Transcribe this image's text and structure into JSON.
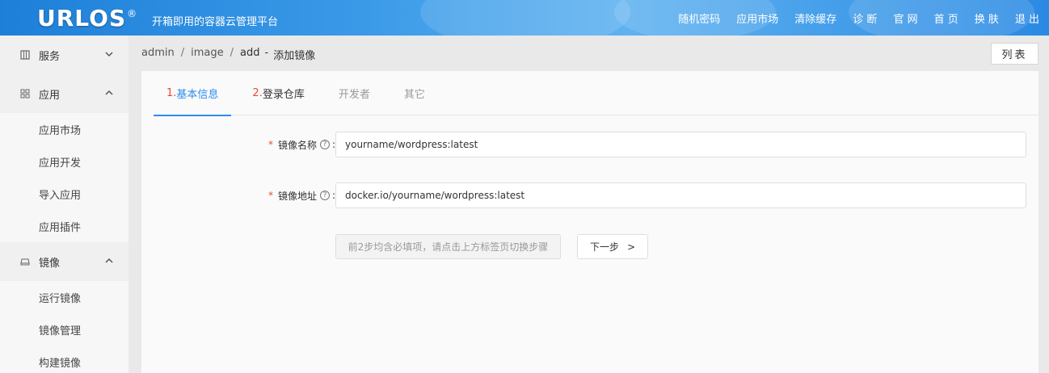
{
  "header": {
    "logo_text": "URLOS",
    "logo_mark": "®",
    "slogan": "开箱即用的容器云管理平台",
    "nav": [
      "随机密码",
      "应用市场",
      "清除缓存",
      "诊 断",
      "官 网",
      "首 页",
      "换 肤",
      "退 出"
    ]
  },
  "sidebar": {
    "groups": [
      {
        "label": "服务",
        "icon": "service-icon",
        "expanded": false,
        "items": []
      },
      {
        "label": "应用",
        "icon": "grid-icon",
        "expanded": true,
        "items": [
          "应用市场",
          "应用开发",
          "导入应用",
          "应用插件"
        ]
      },
      {
        "label": "镜像",
        "icon": "disk-icon",
        "expanded": true,
        "items": [
          "运行镜像",
          "镜像管理",
          "构建镜像"
        ]
      }
    ]
  },
  "breadcrumb": {
    "p1": "admin",
    "p2": "image",
    "p3": "add",
    "dash": "-",
    "title": "添加镜像",
    "sep": "/"
  },
  "list_button": "列表",
  "tabs": [
    {
      "num": "1.",
      "label": "基本信息"
    },
    {
      "num": "2.",
      "label": "登录仓库"
    },
    {
      "num": "",
      "label": "开发者"
    },
    {
      "num": "",
      "label": "其它"
    }
  ],
  "form": {
    "required_mark": "*",
    "help_mark": "?",
    "colon": ":",
    "image_name": {
      "label": "镜像名称",
      "value": "yourname/wordpress:latest"
    },
    "image_address": {
      "label": "镜像地址",
      "value": "docker.io/yourname/wordpress:latest"
    }
  },
  "hint_button": "前2步均含必填项，请点击上方标签页切换步骤",
  "next_button": {
    "label": "下一步",
    "arrow": ">"
  },
  "colors": {
    "accent": "#2d8cf0",
    "required": "#e64d2e",
    "header_blue": "#2a8ae3"
  }
}
